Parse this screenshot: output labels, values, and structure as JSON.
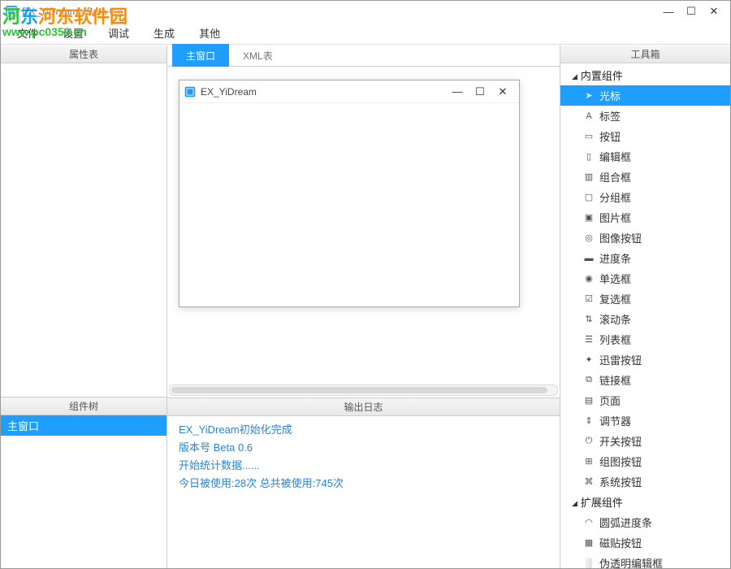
{
  "title": "EX_YiDream - Beta 0.6",
  "watermark": {
    "brand": "河东软件园",
    "url": "www.pc0359.cn"
  },
  "menu": [
    "文件",
    "设置",
    "调试",
    "生成",
    "其他"
  ],
  "panels": {
    "props": "属性表",
    "tree": "组件树",
    "log": "输出日志",
    "toolbox": "工具箱"
  },
  "tabs": [
    {
      "label": "主窗口",
      "active": true
    },
    {
      "label": "XML表",
      "active": false
    }
  ],
  "mock_window_title": "EX_YiDream",
  "tree_items": [
    {
      "label": "主窗口",
      "selected": true
    }
  ],
  "log_lines": [
    "EX_YiDream初始化完成",
    "版本号 Beta 0.6",
    "开始统计数据......",
    "今日被使用:28次 总共被使用:745次"
  ],
  "toolbox": [
    {
      "type": "group",
      "label": "内置组件"
    },
    {
      "type": "item",
      "icon": "➤",
      "label": "光标",
      "selected": true
    },
    {
      "type": "item",
      "icon": "A",
      "label": "标签"
    },
    {
      "type": "item",
      "icon": "▭",
      "label": "按钮"
    },
    {
      "type": "item",
      "icon": "▯",
      "label": "编辑框"
    },
    {
      "type": "item",
      "icon": "▥",
      "label": "组合框"
    },
    {
      "type": "item",
      "icon": "▢",
      "label": "分组框"
    },
    {
      "type": "item",
      "icon": "▣",
      "label": "图片框"
    },
    {
      "type": "item",
      "icon": "◎",
      "label": "图像按钮"
    },
    {
      "type": "item",
      "icon": "▬",
      "label": "进度条"
    },
    {
      "type": "item",
      "icon": "◉",
      "label": "单选框"
    },
    {
      "type": "item",
      "icon": "☑",
      "label": "复选框"
    },
    {
      "type": "item",
      "icon": "⇅",
      "label": "滚动条"
    },
    {
      "type": "item",
      "icon": "☰",
      "label": "列表框"
    },
    {
      "type": "item",
      "icon": "✦",
      "label": "迅雷按钮"
    },
    {
      "type": "item",
      "icon": "⧉",
      "label": "链接框"
    },
    {
      "type": "item",
      "icon": "▤",
      "label": "页面"
    },
    {
      "type": "item",
      "icon": "⇕",
      "label": "调节器"
    },
    {
      "type": "item",
      "icon": "⏻",
      "label": "开关按钮"
    },
    {
      "type": "item",
      "icon": "⊞",
      "label": "组图按钮"
    },
    {
      "type": "item",
      "icon": "⌘",
      "label": "系统按钮"
    },
    {
      "type": "group",
      "label": "扩展组件"
    },
    {
      "type": "item",
      "icon": "◠",
      "label": "圆弧进度条"
    },
    {
      "type": "item",
      "icon": "▦",
      "label": "磁贴按钮"
    },
    {
      "type": "item",
      "icon": "░",
      "label": "伪透明编辑框"
    }
  ]
}
